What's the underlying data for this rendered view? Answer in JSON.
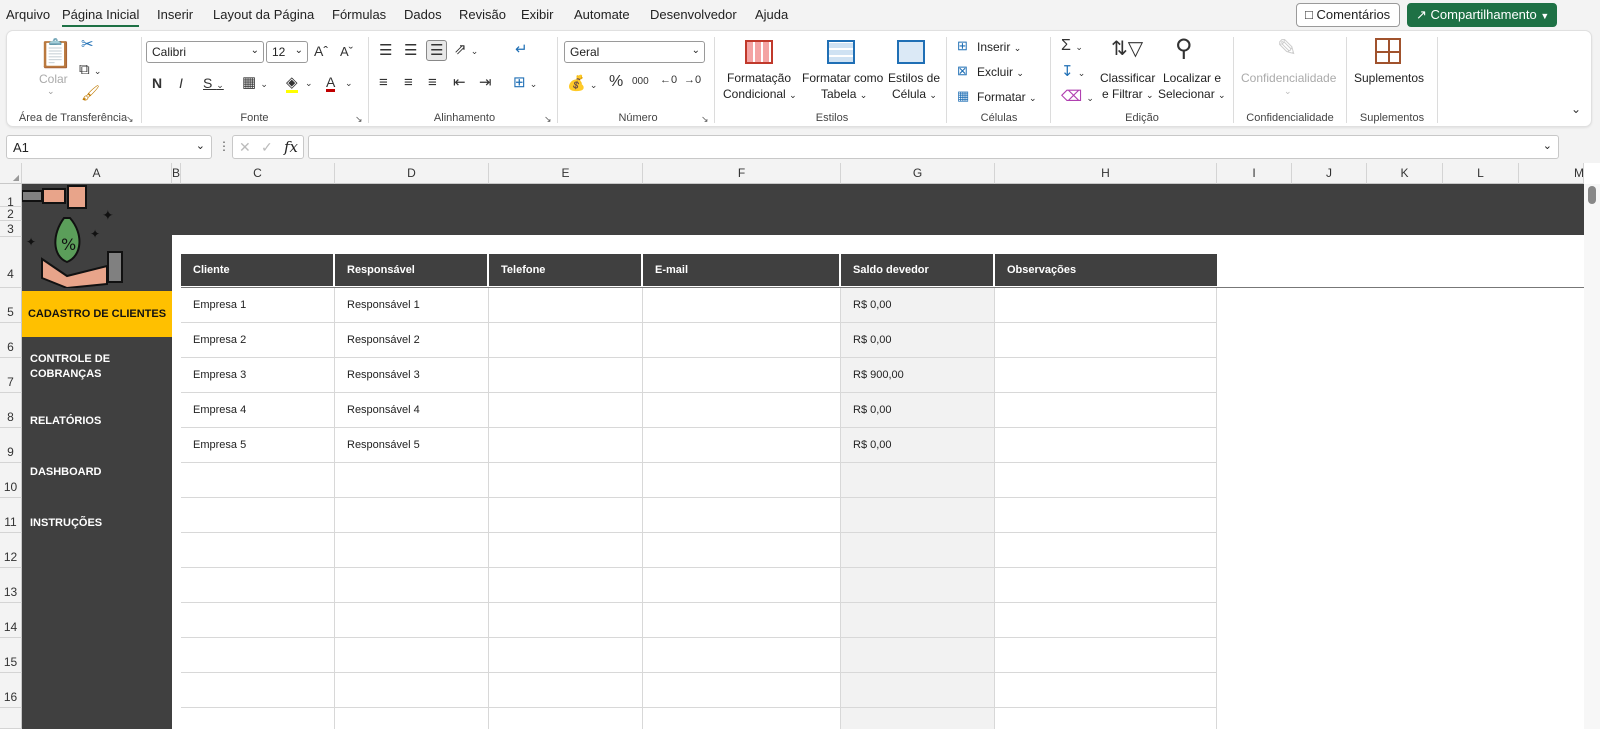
{
  "menu": {
    "items": [
      "Arquivo",
      "Página Inicial",
      "Inserir",
      "Layout da Página",
      "Fórmulas",
      "Dados",
      "Revisão",
      "Exibir",
      "Automate",
      "Desenvolvedor",
      "Ajuda"
    ],
    "comments_label": "Comentários",
    "share_label": "Compartilhamento"
  },
  "ribbon": {
    "clipboard": {
      "paste_label": "Colar",
      "group_label": "Área de Transferência"
    },
    "font": {
      "font_name": "Calibri",
      "font_size": "12",
      "group_label": "Fonte"
    },
    "alignment": {
      "group_label": "Alinhamento"
    },
    "number": {
      "format": "Geral",
      "group_label": "Número"
    },
    "styles": {
      "conditional_line1": "Formatação",
      "conditional_line2": "Condicional",
      "table_line1": "Formatar como",
      "table_line2": "Tabela",
      "cell_line1": "Estilos de",
      "cell_line2": "Célula",
      "group_label": "Estilos"
    },
    "cells": {
      "insert_label": "Inserir",
      "delete_label": "Excluir",
      "format_label": "Formatar",
      "group_label": "Células"
    },
    "editing": {
      "sort_line1": "Classificar",
      "sort_line2": "e Filtrar",
      "find_line1": "Localizar e",
      "find_line2": "Selecionar",
      "group_label": "Edição"
    },
    "sensitivity": {
      "label": "Confidencialidade",
      "group_label": "Confidencialidade"
    },
    "addins": {
      "label": "Suplementos",
      "group_label": "Suplementos"
    }
  },
  "formula_bar": {
    "name_box": "A1",
    "fx": "fx",
    "formula": ""
  },
  "columns": [
    "A",
    "B",
    "C",
    "D",
    "E",
    "F",
    "G",
    "H",
    "I",
    "J",
    "K",
    "L",
    "M"
  ],
  "rows": [
    "1",
    "2",
    "3",
    "4",
    "5",
    "6",
    "7",
    "8",
    "9",
    "10",
    "11",
    "12",
    "13",
    "14",
    "15",
    "16"
  ],
  "sheet": {
    "nav": {
      "active": "CADASTRO DE CLIENTES",
      "controle_line1": "CONTROLE DE",
      "controle_line2": "COBRANÇAS",
      "relatorios": "RELATÓRIOS",
      "dashboard": "DASHBOARD",
      "instrucoes": "INSTRUÇÕES"
    },
    "table": {
      "headers": [
        "Cliente",
        "Responsável",
        "Telefone",
        "E-mail",
        "Saldo devedor",
        "Observações"
      ],
      "rows": [
        {
          "cliente": "Empresa 1",
          "responsavel": "Responsável 1",
          "telefone": "",
          "email": "",
          "saldo": "R$ 0,00",
          "obs": ""
        },
        {
          "cliente": "Empresa 2",
          "responsavel": "Responsável 2",
          "telefone": "",
          "email": "",
          "saldo": "R$ 0,00",
          "obs": ""
        },
        {
          "cliente": "Empresa 3",
          "responsavel": "Responsável 3",
          "telefone": "",
          "email": "",
          "saldo": "R$ 900,00",
          "obs": ""
        },
        {
          "cliente": "Empresa 4",
          "responsavel": "Responsável 4",
          "telefone": "",
          "email": "",
          "saldo": "R$ 0,00",
          "obs": ""
        },
        {
          "cliente": "Empresa 5",
          "responsavel": "Responsável 5",
          "telefone": "",
          "email": "",
          "saldo": "R$ 0,00",
          "obs": ""
        }
      ]
    }
  },
  "colors": {
    "accent": "#1e7145",
    "header_dark": "#404040",
    "nav_active": "#ffc000",
    "saldo_fill": "#f2f2f2"
  }
}
